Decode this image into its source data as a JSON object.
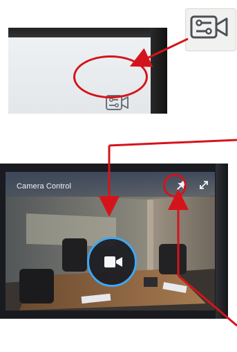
{
  "camera_panel": {
    "title": "Camera Control"
  },
  "icons": {
    "camera_control_icon": "camera-settings-icon",
    "pin_icon": "pin-icon",
    "expand_icon": "expand-icon",
    "video_camera_icon": "video-camera-icon"
  },
  "colors": {
    "annotation_red": "#d4141b",
    "selection_ring_blue": "#3fa8f4"
  }
}
